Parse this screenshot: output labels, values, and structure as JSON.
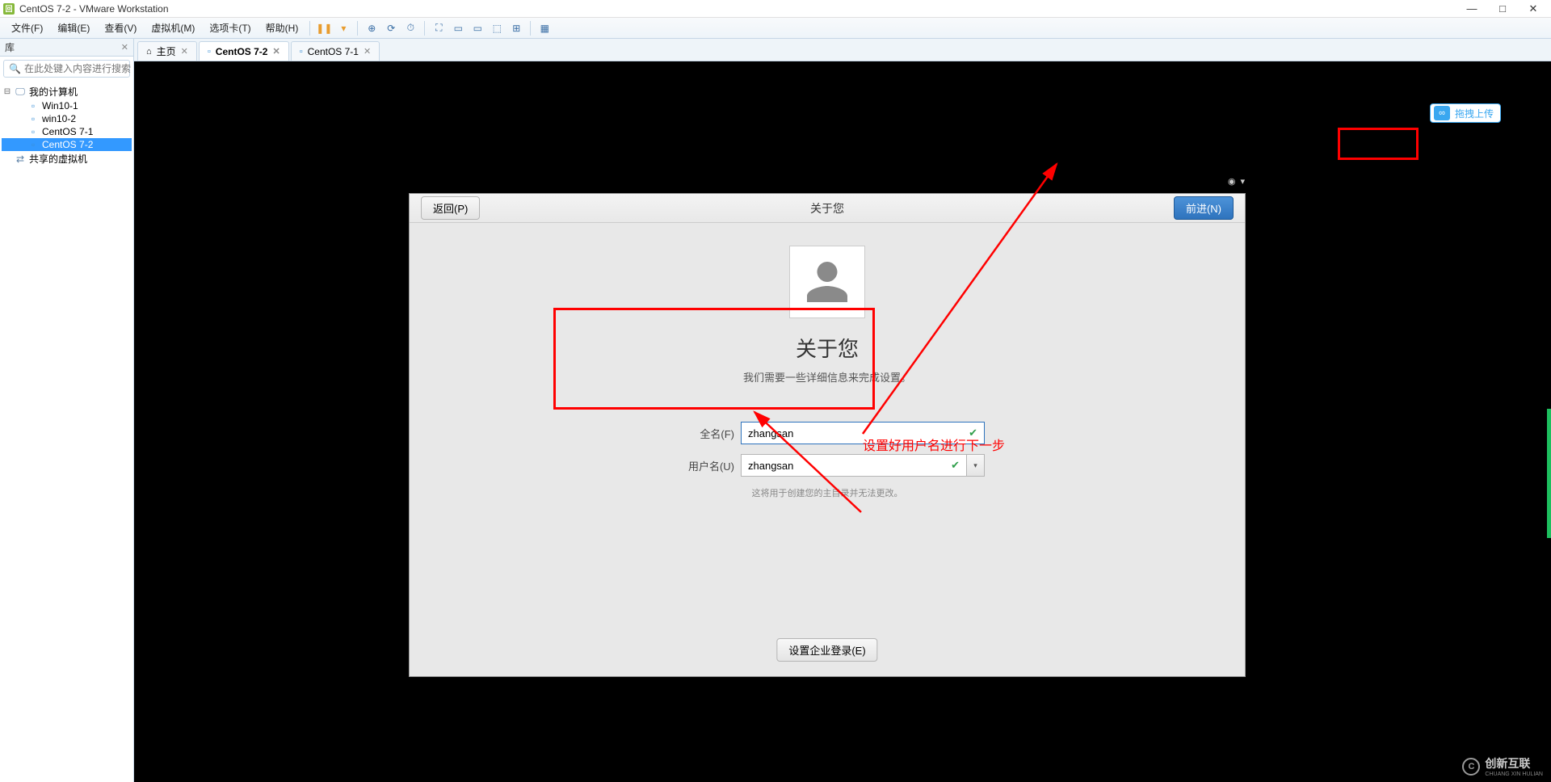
{
  "window": {
    "title": "CentOS 7-2 - VMware Workstation"
  },
  "menubar": {
    "items": [
      "文件(F)",
      "编辑(E)",
      "查看(V)",
      "虚拟机(M)",
      "选项卡(T)",
      "帮助(H)"
    ]
  },
  "sidebar": {
    "header": "库",
    "search_placeholder": "在此处键入内容进行搜索",
    "root": "我的计算机",
    "vms": [
      "Win10-1",
      "win10-2",
      "CentOS 7-1",
      "CentOS 7-2"
    ],
    "shared": "共享的虚拟机"
  },
  "tabs": [
    {
      "label": "主页",
      "icon": "home"
    },
    {
      "label": "CentOS 7-2",
      "icon": "vm",
      "active": true
    },
    {
      "label": "CentOS 7-1",
      "icon": "vm"
    }
  ],
  "setup": {
    "back": "返回(P)",
    "next": "前进(N)",
    "toolbar_title": "关于您",
    "heading": "关于您",
    "sub": "我们需要一些详细信息来完成设置。",
    "fullname_label": "全名(F)",
    "fullname_value": "zhangsan",
    "username_label": "用户名(U)",
    "username_value": "zhangsan",
    "hint": "这将用于创建您的主目录并无法更改。",
    "enterprise": "设置企业登录(E)"
  },
  "upload_badge": "拖拽上传",
  "annotation_text": "设置好用户名进行下一步",
  "watermark": {
    "brand": "创新互联",
    "sub": "CHUANG XIN HULIAN"
  }
}
